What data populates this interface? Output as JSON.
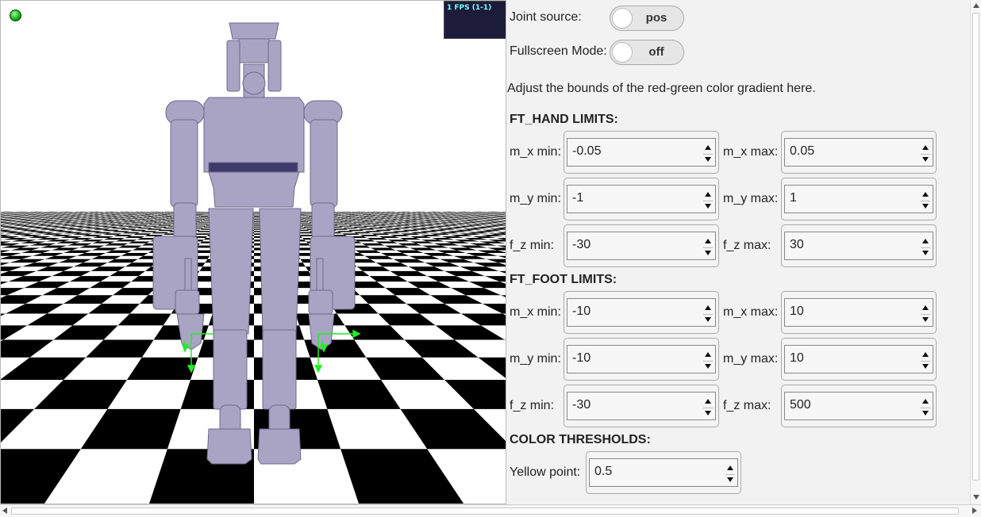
{
  "viewport": {
    "fps_label": "1 FPS (1-1)"
  },
  "controls": {
    "joint_source_label": "Joint source:",
    "joint_source_value": "pos",
    "fullscreen_label": "Fullscreen Mode:",
    "fullscreen_value": "off",
    "note": "Adjust the bounds of the red-green color gradient here."
  },
  "ft_hand": {
    "title": "FT_HAND LIMITS:",
    "mx_min_label": "m_x min:",
    "mx_min": "-0.05",
    "mx_max_label": "m_x max:",
    "mx_max": "0.05",
    "my_min_label": "m_y min:",
    "my_min": "-1",
    "my_max_label": "m_y max:",
    "my_max": "1",
    "fz_min_label": "f_z min:",
    "fz_min": "-30",
    "fz_max_label": "f_z max:",
    "fz_max": "30"
  },
  "ft_foot": {
    "title": "FT_FOOT LIMITS:",
    "mx_min_label": "m_x min:",
    "mx_min": "-10",
    "mx_max_label": "m_x max:",
    "mx_max": "10",
    "my_min_label": "m_y min:",
    "my_min": "-10",
    "my_max_label": "m_y max:",
    "my_max": "10",
    "fz_min_label": "f_z min:",
    "fz_min": "-30",
    "fz_max_label": "f_z max:",
    "fz_max": "500"
  },
  "color_thresholds": {
    "title": "COLOR THRESHOLDS:",
    "yellow_label": "Yellow point:",
    "yellow_value": "0.5"
  },
  "colors": {
    "robot": "#a9a4c4",
    "status_dot": "#22aa22",
    "axis_green": "#22ee22"
  }
}
